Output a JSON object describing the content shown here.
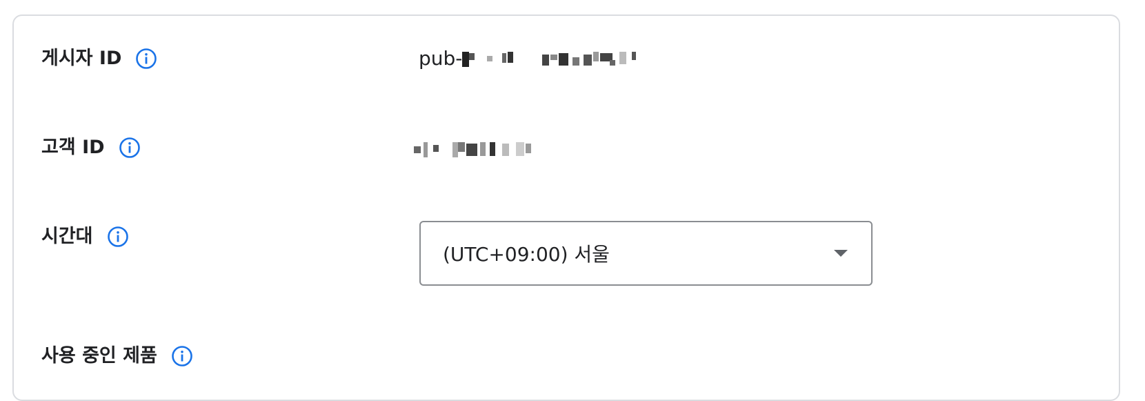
{
  "settings": {
    "publisher_id": {
      "label": "게시자 ID",
      "value_prefix": "pub-",
      "info_icon": "info-icon"
    },
    "customer_id": {
      "label": "고객 ID",
      "info_icon": "info-icon"
    },
    "timezone": {
      "label": "시간대",
      "selected": "(UTC+09:00) 서울",
      "info_icon": "info-icon",
      "dropdown_icon": "arrow-drop-down-icon"
    },
    "products": {
      "label": "사용 중인 제품",
      "info_icon": "info-icon"
    }
  },
  "colors": {
    "info_icon": "#1a73e8",
    "border": "#dadce0",
    "text": "#202124"
  }
}
